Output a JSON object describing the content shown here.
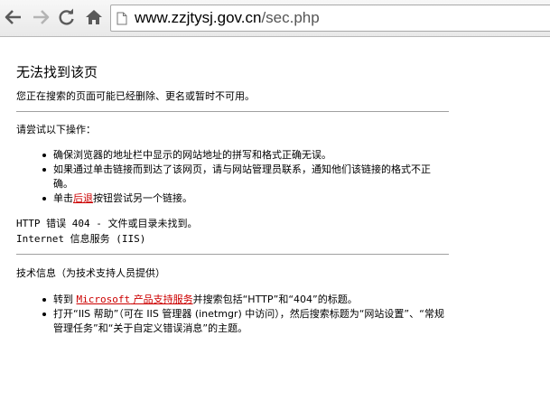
{
  "browser": {
    "url_host": "www.zzjtysj.gov.cn",
    "url_path": "/sec.php"
  },
  "page": {
    "title": "无法找到该页",
    "subtitle": "您正在搜索的页面可能已经删除、更名或暂时不可用。",
    "try_heading": "请尝试以下操作：",
    "try_items": [
      "确保浏览器的地址栏中显示的网站地址的拼写和格式正确无误。",
      "如果通过单击链接而到达了该网页，请与网站管理员联系，通知他们该链接的格式不正确。"
    ],
    "back_prefix": "单击",
    "back_link": "后退",
    "back_suffix": "按钮尝试另一个链接。",
    "error_line": "HTTP 错误 404 - 文件或目录未找到。",
    "server_line": "Internet 信息服务 (IIS)",
    "tech_heading": "技术信息（为技术支持人员提供）",
    "tech_item1_prefix": "转到 ",
    "tech_item1_link_mono": "Microsoft",
    "tech_item1_link_rest": " 产品支持服务",
    "tech_item1_suffix": "并搜索包括“HTTP”和“404”的标题。",
    "tech_item2": "打开“IIS 帮助”（可在 IIS 管理器 (inetmgr) 中访问），然后搜索标题为“网站设置”、“常规管理任务”和“关于自定义错误消息”的主题。"
  }
}
